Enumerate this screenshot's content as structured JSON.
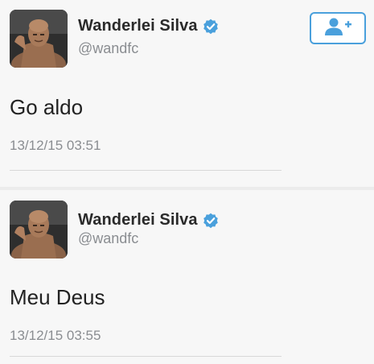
{
  "tweets": [
    {
      "display_name": "Wanderlei Silva",
      "handle": "@wandfc",
      "text": "Go aldo",
      "timestamp": "13/12/15 03:51"
    },
    {
      "display_name": "Wanderlei Silva",
      "handle": "@wandfc",
      "text": "Meu Deus",
      "timestamp": "13/12/15 03:55"
    }
  ],
  "follow_button": {
    "icon": "add-user-icon"
  },
  "colors": {
    "accent": "#4aa0dc",
    "name": "#2a2a2a",
    "secondary": "#8a8d91",
    "verified": "#4aa0dc"
  }
}
